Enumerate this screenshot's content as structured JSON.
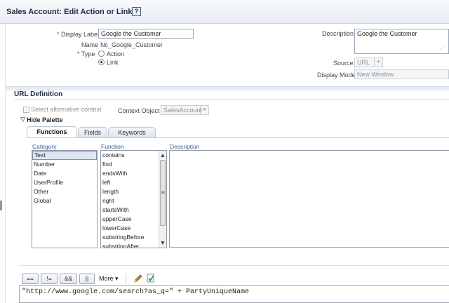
{
  "header": {
    "title": "Sales Account: Edit Action or Link",
    "help_label": "?"
  },
  "form": {
    "display_label": {
      "label": "Display Label",
      "value": "Google the Customer"
    },
    "name": {
      "label": "Name",
      "value": "Nc_Google_Customer"
    },
    "type": {
      "label": "Type",
      "options": [
        "Action",
        "Link"
      ],
      "selected": "Link"
    },
    "description": {
      "label": "Description",
      "value": "Google the Customer"
    },
    "source": {
      "label": "Source",
      "value": "URL"
    },
    "display_mode": {
      "label": "Display Mode",
      "value": "New Window"
    },
    "required_marker": "*"
  },
  "url_definition": {
    "title": "URL Definition",
    "alt_context_label": "Select alternative context",
    "context_object_label": "Context Object",
    "context_object_value": "SalesAccount",
    "hide_palette_label": "Hide Palette",
    "toggle_glyph": "▽"
  },
  "tabs": [
    {
      "label": "Functions",
      "active": true
    },
    {
      "label": "Fields",
      "active": false
    },
    {
      "label": "Keywords",
      "active": false
    }
  ],
  "palette": {
    "category_header": "Category",
    "function_header": "Function",
    "description_header": "Description",
    "categories": [
      "Text",
      "Number",
      "Date",
      "UserProfile",
      "Other",
      "Global"
    ],
    "selected_category": "Text",
    "functions": [
      "contains",
      "find",
      "endsWith",
      "left",
      "length",
      "right",
      "startsWith",
      "upperCase",
      "lowerCase",
      "substringBefore",
      "substringAfter"
    ],
    "scroll_up": "▲",
    "scroll_mid": "≡",
    "scroll_down": "▼"
  },
  "operators": {
    "buttons": [
      "==",
      "!=",
      "&&",
      "||"
    ],
    "more_label": "More",
    "more_arrow": "▾",
    "icons": [
      "pencil-icon",
      "validate-icon"
    ]
  },
  "expression": "\"http://www.google.com/search?as_q=\" + PartyUniqueName",
  "colors": {
    "accent": "#3a5c8a",
    "header_bg": "#e9eef4",
    "selection": "#dde6f1"
  }
}
